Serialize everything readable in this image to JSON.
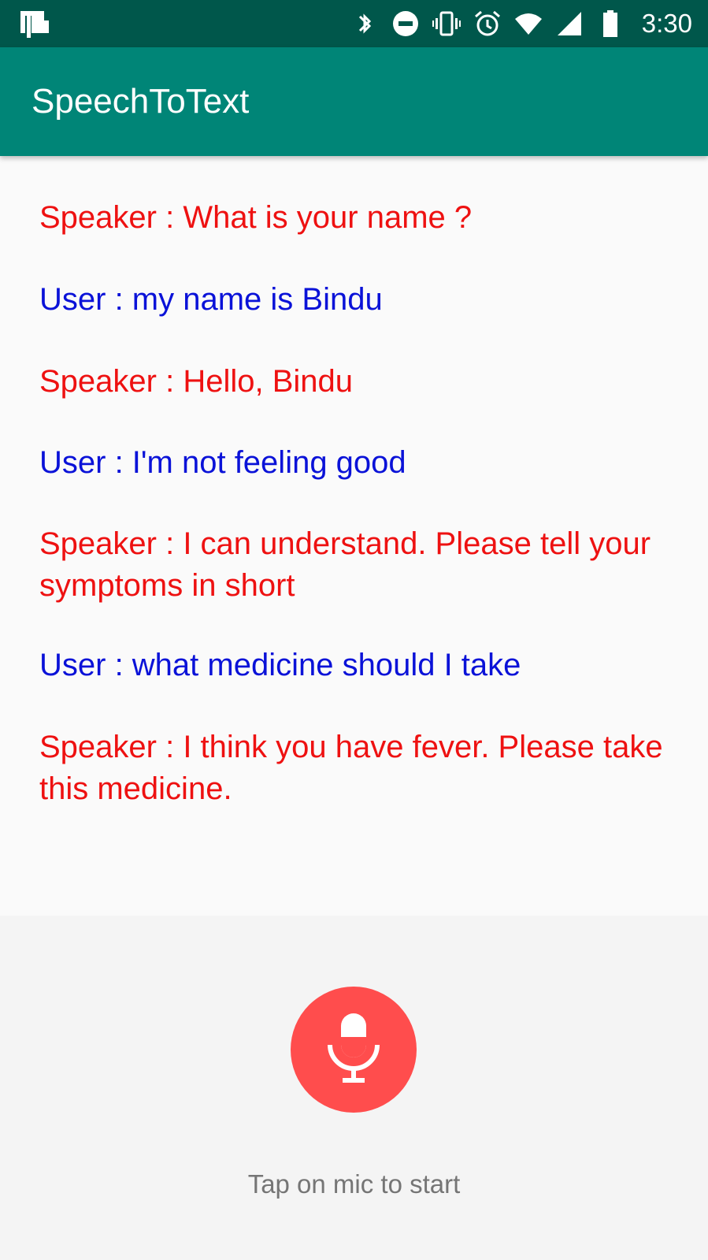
{
  "status_bar": {
    "time": "3:30",
    "icons": [
      "device-notification-icon",
      "bluetooth-icon",
      "do-not-disturb-icon",
      "vibrate-icon",
      "alarm-icon",
      "wifi-icon",
      "cell-signal-icon",
      "battery-icon"
    ]
  },
  "app_bar": {
    "title": "SpeechToText",
    "color": "#008577"
  },
  "conversation": {
    "messages": [
      {
        "role": "speaker",
        "text": "Speaker : What is your name ?"
      },
      {
        "role": "user",
        "text": "User : my name is Bindu"
      },
      {
        "role": "speaker",
        "text": "Speaker : Hello, Bindu"
      },
      {
        "role": "user",
        "text": "User : I'm not feeling good"
      },
      {
        "role": "speaker",
        "text": "Speaker : I can understand. Please tell your symptoms in short"
      },
      {
        "role": "user",
        "text": "User : what medicine should I take"
      },
      {
        "role": "speaker",
        "text": "Speaker : I think you have fever. Please take this medicine."
      }
    ],
    "speaker_color": "#ee1111",
    "user_color": "#0a12d8"
  },
  "mic": {
    "icon": "microphone-icon",
    "color": "#ff4d4d",
    "hint": "Tap on mic to start"
  }
}
